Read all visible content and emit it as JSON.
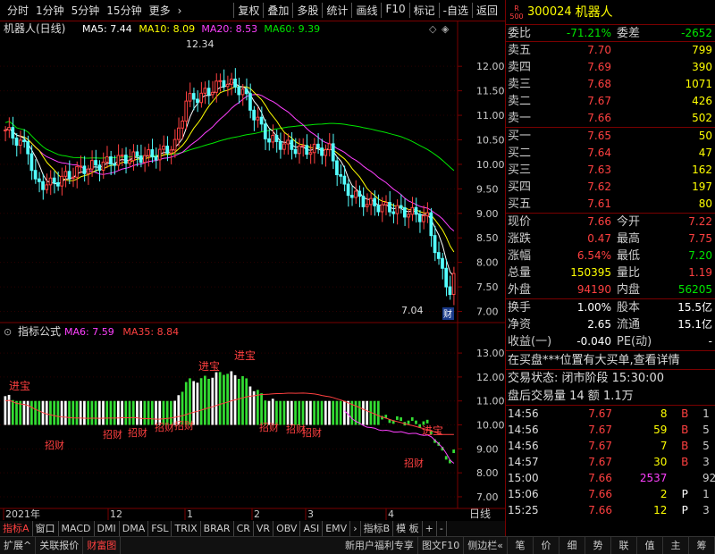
{
  "toolbar": {
    "left": [
      "分时",
      "1分钟",
      "5分钟",
      "15分钟",
      "更多",
      "›"
    ],
    "right": [
      "复权",
      "叠加",
      "多股",
      "统计",
      "画线",
      "F10",
      "标记",
      "-自选",
      "返回"
    ]
  },
  "chart_data": {
    "type": "line",
    "title": "机器人(日线)",
    "ma_legend": [
      {
        "name": "MA5",
        "value": "7.44",
        "color": "#ffffff"
      },
      {
        "name": "MA10",
        "value": "8.09",
        "color": "#ffff00"
      },
      {
        "name": "MA20",
        "value": "8.53",
        "color": "#ff40ff"
      },
      {
        "name": "MA60",
        "value": "9.39",
        "color": "#00e600"
      }
    ],
    "y_ticks": [
      "12.00",
      "11.50",
      "11.00",
      "10.50",
      "10.00",
      "9.50",
      "9.00",
      "8.50",
      "8.00",
      "7.50",
      "7.00"
    ],
    "ylim": [
      6.9,
      12.55
    ],
    "high_annot": "12.34",
    "low_annot": "7.04",
    "cai": "财",
    "ind_title": "指标公式",
    "ind_legend": [
      {
        "name": "MA6",
        "value": "7.59",
        "color": "#ff40ff"
      },
      {
        "name": "MA35",
        "value": "8.84",
        "color": "#ff4040"
      }
    ],
    "ind_ticks": [
      "13.00",
      "12.00",
      "11.00",
      "10.00",
      "9.00",
      "8.00",
      "7.00"
    ],
    "ind_ylim": [
      6.7,
      13.6
    ],
    "x_labels": [
      "2021年",
      "12",
      "1",
      "2",
      "3",
      "4"
    ],
    "period": "日线",
    "labels_up": [
      "进宝",
      "进宝",
      "进宝",
      "进宝"
    ],
    "labels_down": [
      "招财",
      "招财",
      "招财",
      "招财",
      "招财",
      "招财",
      "招财",
      "招财",
      "招财"
    ]
  },
  "bottom_tabs": [
    "指标A",
    "窗口",
    "MACD",
    "DMI",
    "DMA",
    "FSL",
    "TRIX",
    "BRAR",
    "CR",
    "VR",
    "OBV",
    "ASI",
    "EMV",
    "›",
    "指标B",
    "模 板",
    "+",
    "-"
  ],
  "status_left": [
    "扩展^",
    "关联报价",
    "财富图"
  ],
  "status_mid": [
    "新用户福利专享",
    "图文F10",
    "侧边栏«"
  ],
  "status_right": [
    "笔",
    "价",
    "细",
    "势",
    "联",
    "值",
    "主",
    "筹"
  ],
  "quote": {
    "code": "300024",
    "name": "机器人",
    "badge": "R",
    "badge2": "500",
    "webi": {
      "l1": "委比",
      "v1": "-71.21%",
      "l2": "委差",
      "v2": "-2652"
    },
    "asks": [
      {
        "label": "卖五",
        "price": "7.70",
        "vol": "799"
      },
      {
        "label": "卖四",
        "price": "7.69",
        "vol": "390"
      },
      {
        "label": "卖三",
        "price": "7.68",
        "vol": "1071"
      },
      {
        "label": "卖二",
        "price": "7.67",
        "vol": "426"
      },
      {
        "label": "卖一",
        "price": "7.66",
        "vol": "502"
      }
    ],
    "bids": [
      {
        "label": "买一",
        "price": "7.65",
        "vol": "50"
      },
      {
        "label": "买二",
        "price": "7.64",
        "vol": "47"
      },
      {
        "label": "买三",
        "price": "7.63",
        "vol": "162"
      },
      {
        "label": "买四",
        "price": "7.62",
        "vol": "197"
      },
      {
        "label": "买五",
        "price": "7.61",
        "vol": "80"
      }
    ],
    "stats": [
      {
        "l1": "现价",
        "v1": "7.66",
        "c1": "red",
        "l2": "今开",
        "v2": "7.22",
        "c2": "red"
      },
      {
        "l1": "涨跌",
        "v1": "0.47",
        "c1": "red",
        "l2": "最高",
        "v2": "7.75",
        "c2": "red"
      },
      {
        "l1": "涨幅",
        "v1": "6.54%",
        "c1": "red",
        "l2": "最低",
        "v2": "7.20",
        "c2": "grn"
      },
      {
        "l1": "总量",
        "v1": "150395",
        "c1": "yel",
        "l2": "量比",
        "v2": "1.19",
        "c2": "red"
      },
      {
        "l1": "外盘",
        "v1": "94190",
        "c1": "red",
        "l2": "内盘",
        "v2": "56205",
        "c2": "grn"
      }
    ],
    "stats2": [
      {
        "l1": "换手",
        "v1": "1.00%",
        "l2": "股本",
        "v2": "15.5亿"
      },
      {
        "l1": "净资",
        "v1": "2.65",
        "l2": "流通",
        "v2": "15.1亿"
      },
      {
        "l1": "收益(一)",
        "v1": "-0.040",
        "l2": "PE(动)",
        "v2": "-"
      }
    ],
    "notice": "在买盘***位置有大买单,查看详情",
    "trade_state": "交易状态: 闭市阶段 15:30:00",
    "after": "盘后交易量 14 额 1.1万",
    "ticks": [
      {
        "t": "14:56",
        "p": "7.67",
        "v": "8",
        "f": "B",
        "n": "1",
        "vc": "yel",
        "fc": "red"
      },
      {
        "t": "14:56",
        "p": "7.67",
        "v": "59",
        "f": "B",
        "n": "5",
        "vc": "yel",
        "fc": "red"
      },
      {
        "t": "14:56",
        "p": "7.67",
        "v": "7",
        "f": "B",
        "n": "5",
        "vc": "yel",
        "fc": "red"
      },
      {
        "t": "14:57",
        "p": "7.67",
        "v": "30",
        "f": "B",
        "n": "3",
        "vc": "yel",
        "fc": "red"
      },
      {
        "t": "15:00",
        "p": "7.66",
        "v": "2537",
        "f": "",
        "n": "92",
        "vc": "mag",
        "fc": "red"
      },
      {
        "t": "15:06",
        "p": "7.66",
        "v": "2",
        "f": "P",
        "n": "1",
        "vc": "yel",
        "fc": "wht"
      },
      {
        "t": "15:25",
        "p": "7.66",
        "v": "12",
        "f": "P",
        "n": "3",
        "vc": "yel",
        "fc": "wht"
      }
    ]
  }
}
